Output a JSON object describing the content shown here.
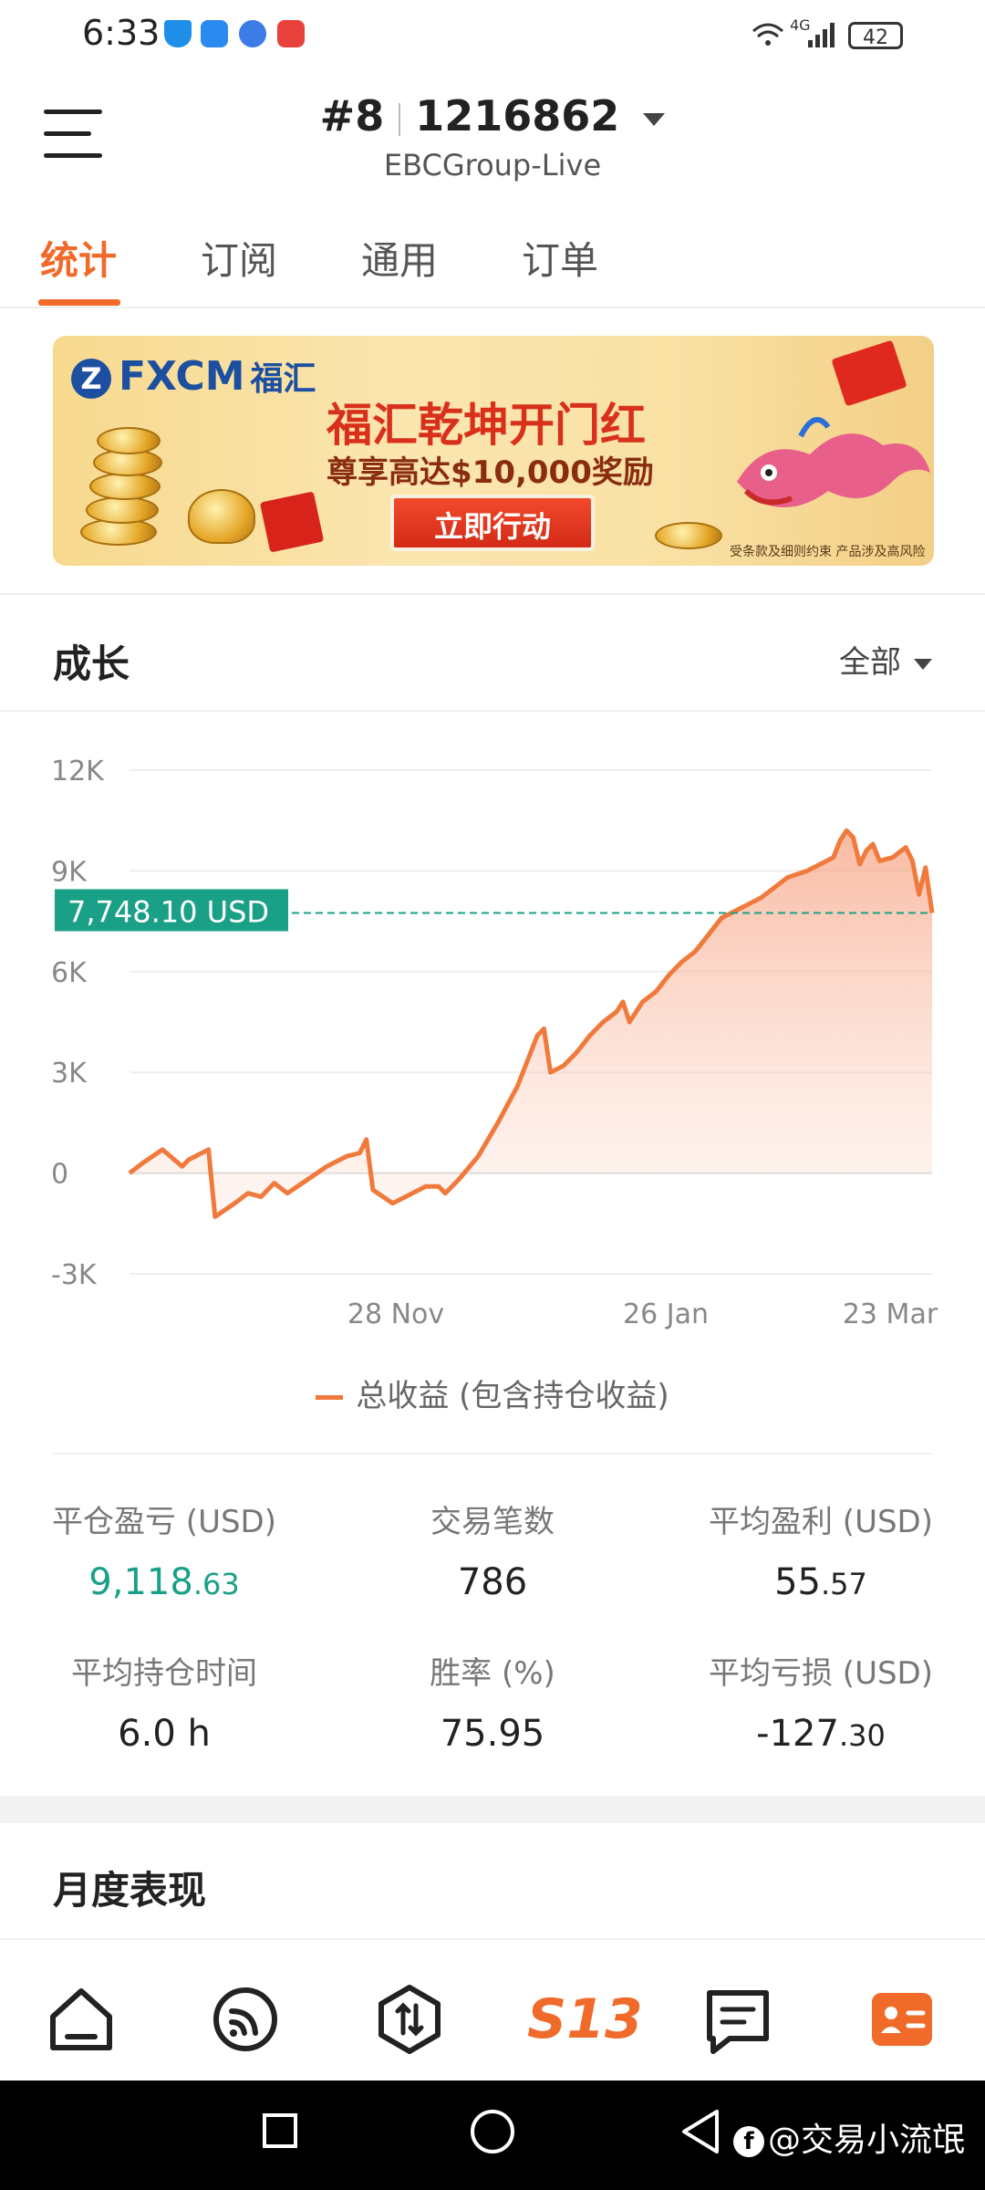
{
  "status_bar": {
    "time": "6:33",
    "network": "4G",
    "battery": "42"
  },
  "header": {
    "account_number": "#8",
    "account_id": "1216862",
    "server": "EBCGroup-Live"
  },
  "tabs": [
    {
      "label": "统计",
      "active": true
    },
    {
      "label": "订阅",
      "active": false
    },
    {
      "label": "通用",
      "active": false
    },
    {
      "label": "订单",
      "active": false
    }
  ],
  "banner": {
    "brand": "FXCM",
    "brand_cn": "福汇",
    "title": "福汇乾坤开门红",
    "subtitle": "尊享高达$10,000奖励",
    "cta": "立即行动",
    "fine_print": "受条款及细则约束  产品涉及高风险"
  },
  "growth": {
    "title": "成长",
    "range": "全部"
  },
  "chart_data": {
    "type": "area",
    "x": [
      "28 Nov",
      "26 Jan",
      "23 Mar"
    ],
    "y_ticks": [
      "12K",
      "9K",
      "6K",
      "3K",
      "0",
      "-3K"
    ],
    "ylim": [
      -3000,
      12000
    ],
    "current_value_label": "7,748.10 USD",
    "current_value": 7748.1,
    "series": [
      {
        "name": "总收益 (包含持仓收益)",
        "points": [
          [
            0,
            0
          ],
          [
            2,
            300
          ],
          [
            5,
            700
          ],
          [
            8,
            200
          ],
          [
            9,
            400
          ],
          [
            12,
            700
          ],
          [
            13,
            -1300
          ],
          [
            16,
            -900
          ],
          [
            18,
            -600
          ],
          [
            20,
            -700
          ],
          [
            22,
            -300
          ],
          [
            24,
            -600
          ],
          [
            27,
            -200
          ],
          [
            30,
            200
          ],
          [
            33,
            500
          ],
          [
            35,
            600
          ],
          [
            36,
            1000
          ],
          [
            37,
            -500
          ],
          [
            40,
            -900
          ],
          [
            42,
            -700
          ],
          [
            45,
            -400
          ],
          [
            47,
            -400
          ],
          [
            48,
            -600
          ],
          [
            50,
            -200
          ],
          [
            53,
            500
          ],
          [
            56,
            1500
          ],
          [
            59,
            2600
          ],
          [
            61,
            3600
          ],
          [
            62,
            4100
          ],
          [
            63,
            4300
          ],
          [
            64,
            3000
          ],
          [
            66,
            3200
          ],
          [
            68,
            3600
          ],
          [
            70,
            4100
          ],
          [
            72,
            4500
          ],
          [
            74,
            4800
          ],
          [
            75,
            5100
          ],
          [
            76,
            4500
          ],
          [
            78,
            5100
          ],
          [
            80,
            5400
          ],
          [
            82,
            5900
          ],
          [
            84,
            6300
          ],
          [
            86,
            6600
          ],
          [
            88,
            7100
          ],
          [
            90,
            7600
          ],
          [
            92,
            7800
          ],
          [
            94,
            8000
          ],
          [
            96,
            8200
          ],
          [
            98,
            8500
          ],
          [
            100,
            8800
          ],
          [
            103,
            9000
          ],
          [
            105,
            9200
          ],
          [
            107,
            9400
          ],
          [
            108,
            9900
          ],
          [
            109,
            10200
          ],
          [
            110,
            10000
          ],
          [
            111,
            9200
          ],
          [
            112,
            9600
          ],
          [
            113,
            9800
          ],
          [
            114,
            9300
          ],
          [
            116,
            9400
          ],
          [
            118,
            9700
          ],
          [
            119,
            9300
          ],
          [
            120,
            8300
          ],
          [
            121,
            9100
          ],
          [
            122,
            7748
          ]
        ]
      }
    ],
    "legend": "总收益 (包含持仓收益)",
    "grid": true
  },
  "stats": [
    {
      "label": "平仓盈亏 (USD)",
      "int": "9,118",
      "dec": ".63",
      "highlight": true
    },
    {
      "label": "交易笔数",
      "int": "786",
      "dec": "",
      "highlight": false
    },
    {
      "label": "平均盈利 (USD)",
      "int": "55",
      "dec": ".57",
      "highlight": false
    },
    {
      "label": "平均持仓时间",
      "int": "6.0 h",
      "dec": "",
      "highlight": false
    },
    {
      "label": "胜率 (%)",
      "int": "75.95",
      "dec": "",
      "highlight": false
    },
    {
      "label": "平均亏损 (USD)",
      "int": "-127",
      "dec": ".30",
      "highlight": false
    }
  ],
  "monthly": {
    "title": "月度表现"
  },
  "bottom_nav": [
    {
      "icon": "home-icon"
    },
    {
      "icon": "signal-feed-icon"
    },
    {
      "icon": "trade-icon"
    },
    {
      "icon": "s13-logo-icon",
      "label": "S13"
    },
    {
      "icon": "message-icon"
    },
    {
      "icon": "profile-card-icon",
      "active": true
    }
  ],
  "accent_color": "#f06a2a",
  "green_color": "#1aa086",
  "watermark": "@交易小流氓"
}
